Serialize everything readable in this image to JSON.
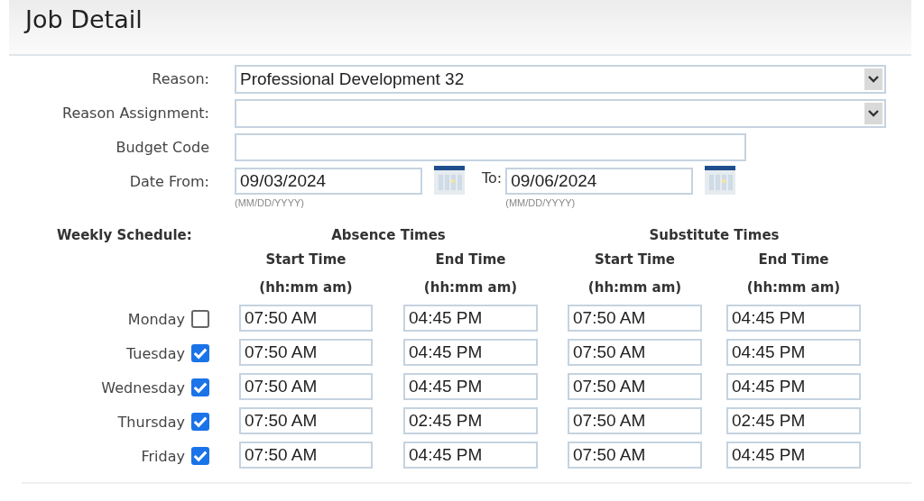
{
  "title": "Job Detail",
  "form": [
    {
      "kind": "dropdown",
      "label": "Reason:",
      "value": "Professional Development 32"
    },
    {
      "kind": "dropdown",
      "label": "Reason Assignment:"
    },
    {
      "kind": "text",
      "label": "Budget Code"
    },
    {
      "kind": "daterange",
      "label": "Date From:",
      "value": "09/03/2024",
      "hint": "(MM/DD/YYYY)",
      "to_label": "To:",
      "to_value": "09/06/2024",
      "to_hint": "(MM/DD/YYYY)"
    }
  ],
  "schedule": {
    "label": "Weekly Schedule:",
    "groups": [
      "Absence Times",
      "Substitute Times"
    ],
    "columns": [
      {
        "title": "Start Time",
        "format": "(hh:mm am)"
      },
      {
        "title": "End Time",
        "format": "(hh:mm am)"
      },
      {
        "title": "Start Time",
        "format": "(hh:mm am)"
      },
      {
        "title": "End Time",
        "format": "(hh:mm am)"
      }
    ],
    "rows": [
      {
        "day": "Monday",
        "checked": false,
        "times": [
          "07:50 AM",
          "04:45 PM",
          "07:50 AM",
          "04:45 PM"
        ]
      },
      {
        "day": "Tuesday",
        "checked": true,
        "times": [
          "07:50 AM",
          "04:45 PM",
          "07:50 AM",
          "04:45 PM"
        ]
      },
      {
        "day": "Wednesday",
        "checked": true,
        "times": [
          "07:50 AM",
          "04:45 PM",
          "07:50 AM",
          "04:45 PM"
        ]
      },
      {
        "day": "Thursday",
        "checked": true,
        "times": [
          "07:50 AM",
          "02:45 PM",
          "07:50 AM",
          "02:45 PM"
        ]
      },
      {
        "day": "Friday",
        "checked": true,
        "times": [
          "07:50 AM",
          "04:45 PM",
          "07:50 AM",
          "04:45 PM"
        ]
      }
    ]
  }
}
